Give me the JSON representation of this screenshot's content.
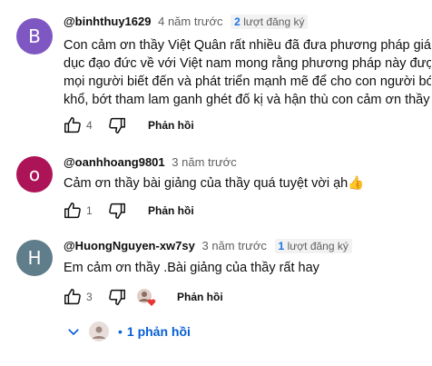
{
  "comments": [
    {
      "avatar_letter": "B",
      "avatar_color": "#7e57c2",
      "handle": "@binhthuy1629",
      "time": "4 năm trước",
      "badge_num": "2",
      "badge_text": "lượt đăng ký",
      "lines": [
        "Con cảm ơn thầy Việt Quân rất nhiều đã đưa phương pháp giáo",
        "dục đạo đức về với Việt nam mong rằng phương pháp này được",
        "mọi người biết đến và phát triển mạnh mẽ để cho con người bớt",
        "khổ, bớt tham lam ganh ghét đố kị và hận thù con cảm ơn thầy ạ"
      ],
      "likes": "4",
      "reply_label": "Phản hồi"
    },
    {
      "avatar_letter": "o",
      "avatar_color": "#ad1457",
      "handle": "@oanhhoang9801",
      "time": "3 năm trước",
      "text": "Cảm ơn thầy bài giảng của thầy quá tuyệt vời ạh👍",
      "likes": "1",
      "reply_label": "Phản hồi"
    },
    {
      "avatar_letter": "H",
      "avatar_color": "#607d8b",
      "handle": "@HuongNguyen-xw7sy",
      "time": "3 năm trước",
      "badge_num": "1",
      "badge_text": "lượt đăng ký",
      "text": "Em cảm ơn thầy .Bài giảng của thầy rất hay",
      "likes": "3",
      "reply_label": "Phản hồi",
      "replies_label": "1 phản hồi"
    }
  ]
}
